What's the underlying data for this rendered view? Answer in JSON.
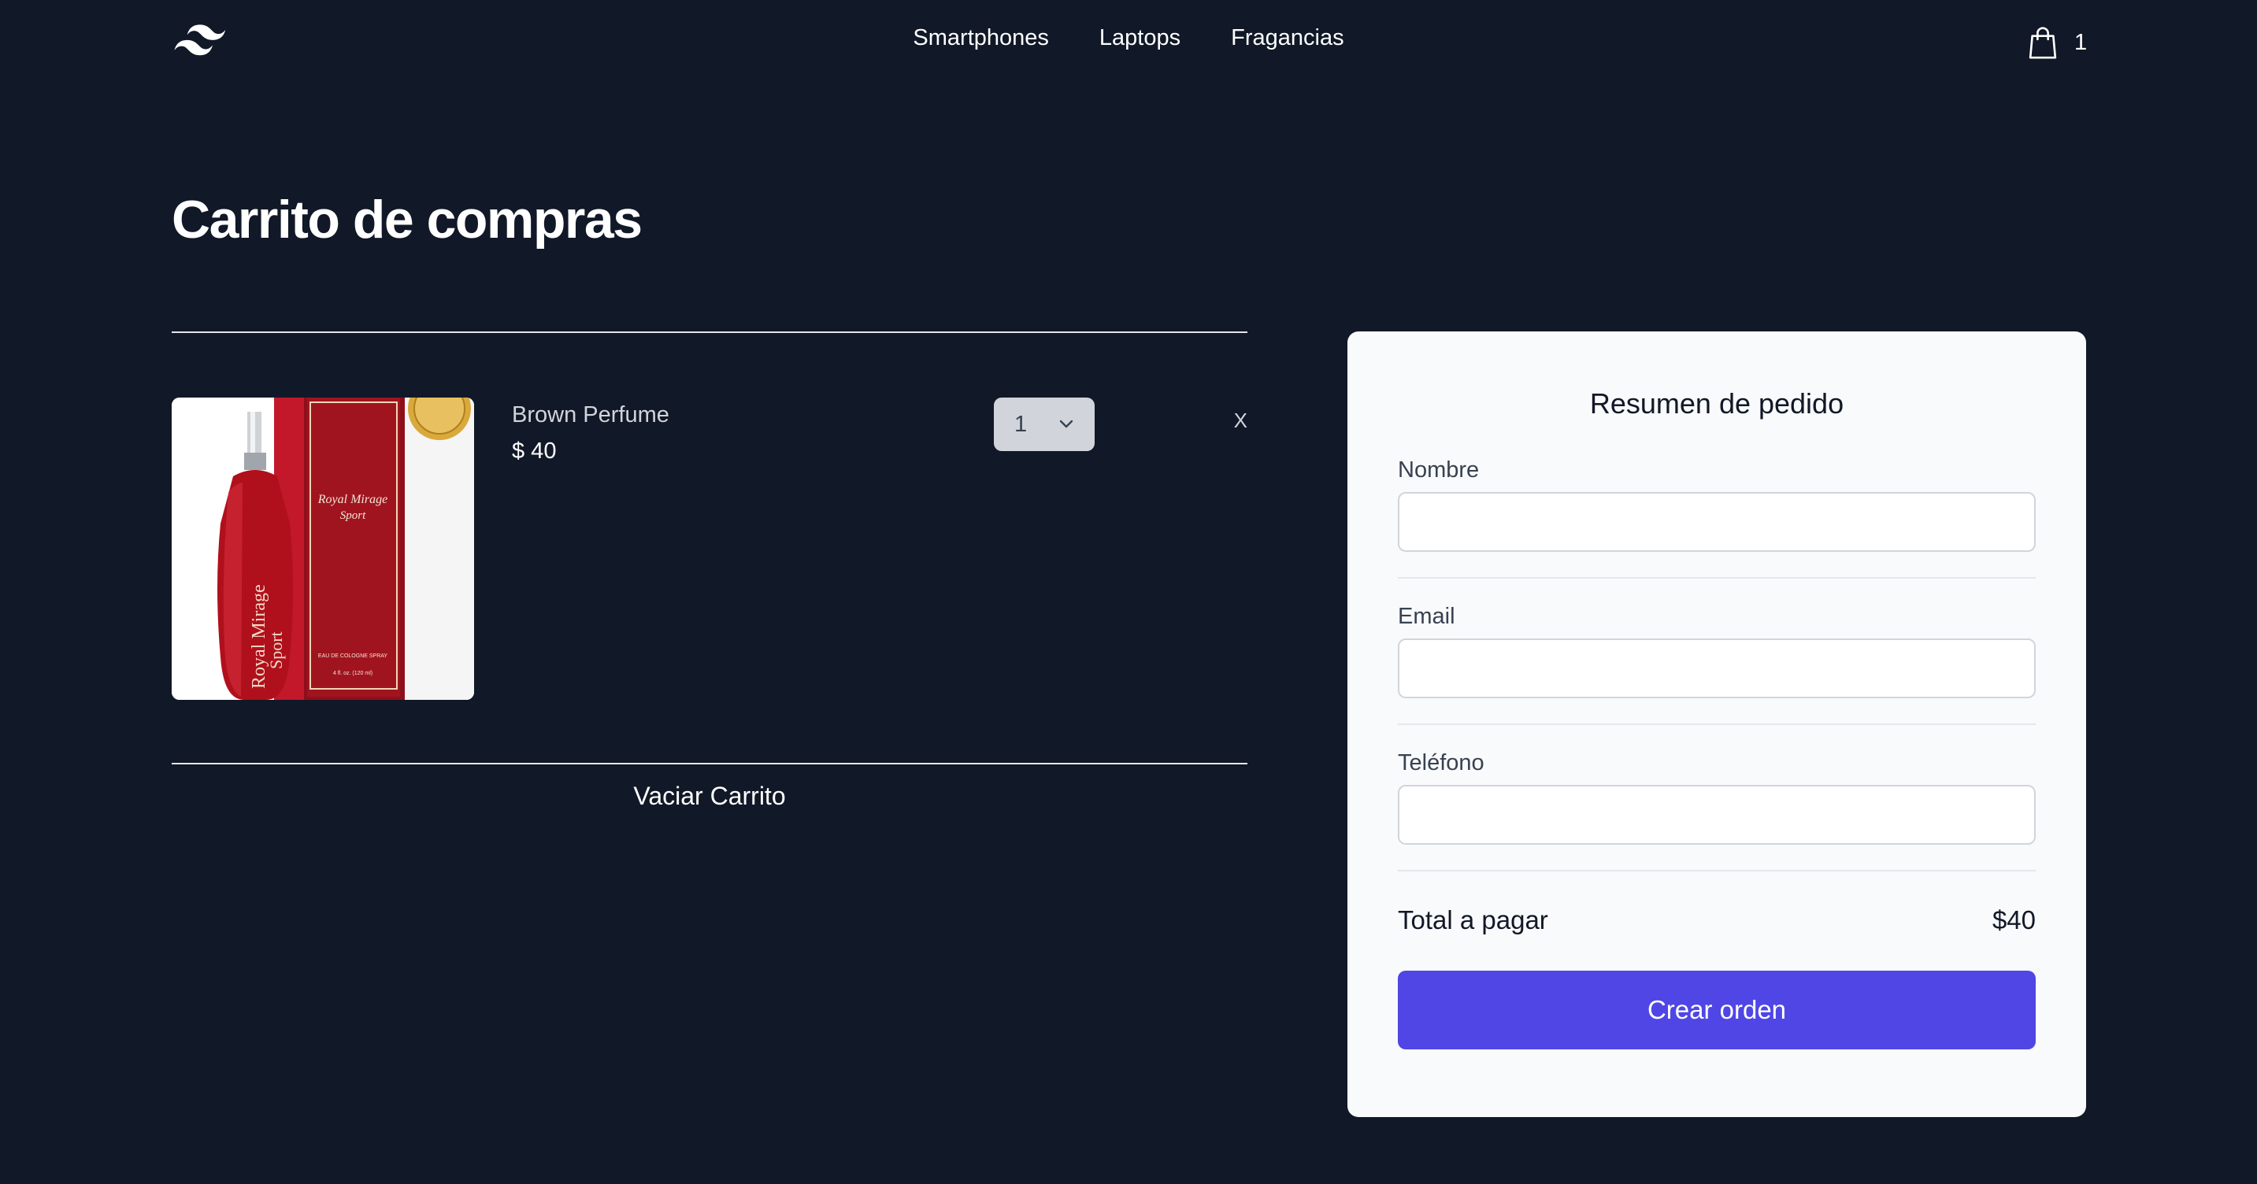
{
  "header": {
    "logo": "wave-logo",
    "nav": [
      "Smartphones",
      "Laptops",
      "Fragancias"
    ],
    "cart_icon": "shopping-bag-icon",
    "cart_count": "1"
  },
  "main": {
    "title": "Carrito de compras",
    "items": [
      {
        "name": "Brown Perfume",
        "price": "$ 40",
        "quantity": "1",
        "remove_label": "X",
        "image_text": {
          "brand": "Royal Mirage",
          "line": "Sport",
          "label": "EAU DE COLOGNE SPRAY",
          "volume": "4 fl. oz. (120 ml)"
        }
      }
    ],
    "empty_cart_label": "Vaciar Carrito"
  },
  "summary": {
    "title": "Resumen de pedido",
    "fields": [
      {
        "label": "Nombre",
        "value": ""
      },
      {
        "label": "Email",
        "value": ""
      },
      {
        "label": "Teléfono",
        "value": ""
      }
    ],
    "total_label": "Total a pagar",
    "total_value": "$40",
    "submit_label": "Crear orden"
  },
  "colors": {
    "background": "#111827",
    "panel": "#f9fafb",
    "accent": "#4f46e5",
    "product_red": "#b0101c"
  }
}
